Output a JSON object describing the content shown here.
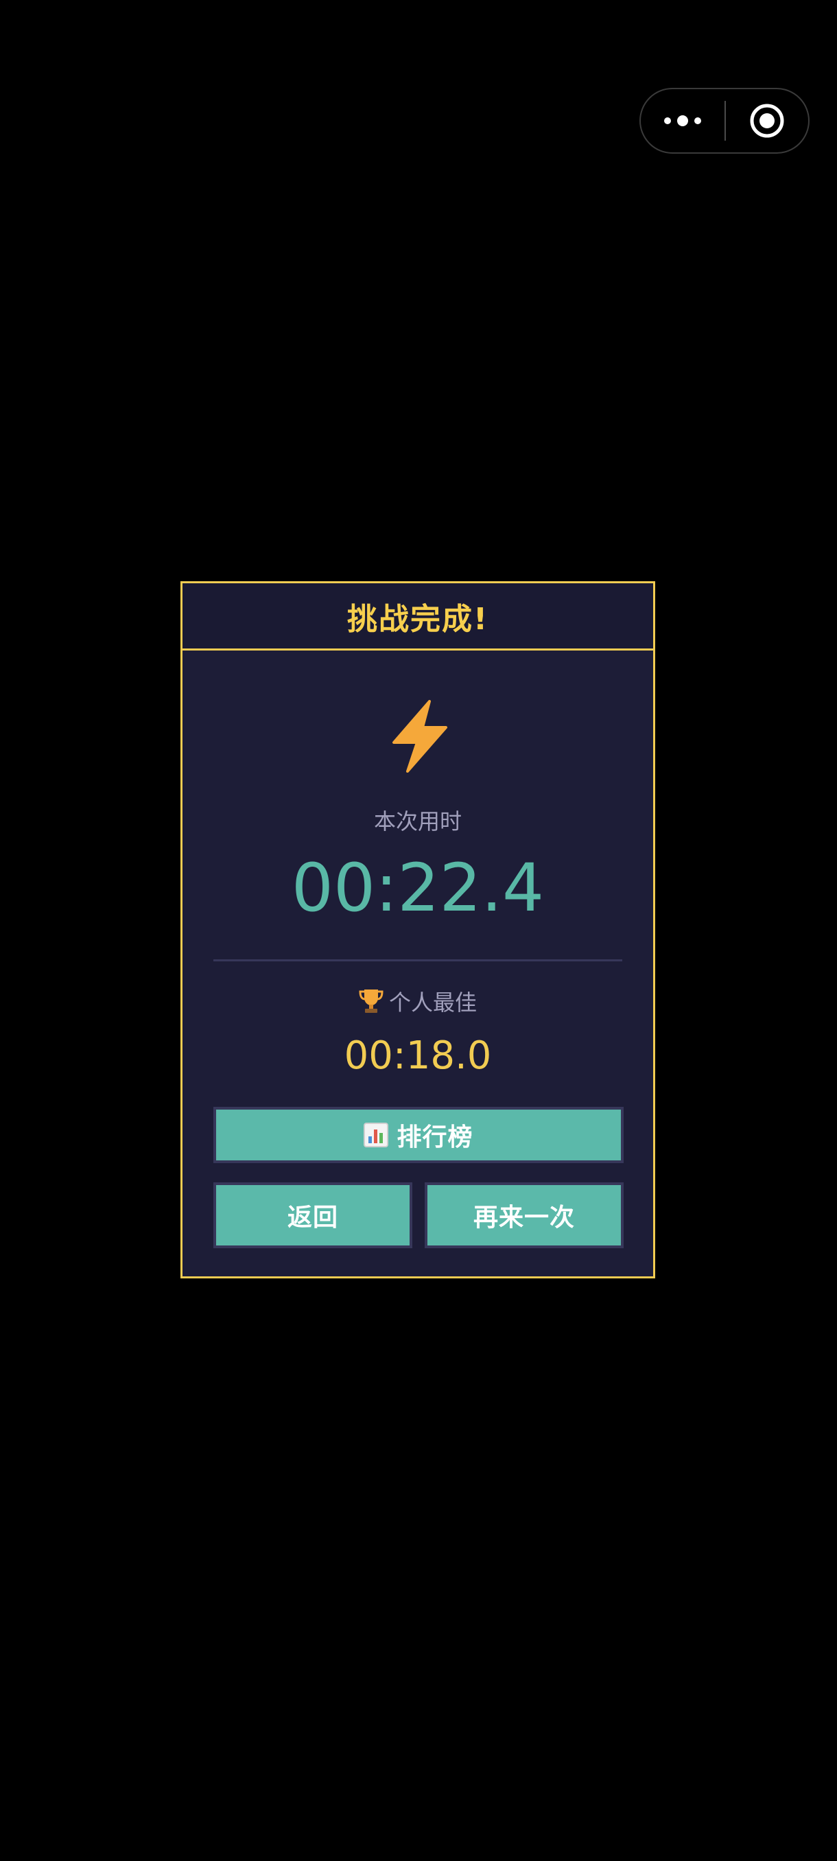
{
  "capsule": {
    "more_icon": "more-dots-icon",
    "close_icon": "target-circle-icon"
  },
  "modal": {
    "title": "挑战完成!",
    "icon": "lightning-bolt-icon",
    "current": {
      "label": "本次用时",
      "value": "00:22.4"
    },
    "best": {
      "icon": "trophy-icon",
      "label": "个人最佳",
      "value": "00:18.0"
    },
    "buttons": {
      "leaderboard_icon": "bar-chart-icon",
      "leaderboard": "排行榜",
      "back": "返回",
      "retry": "再来一次"
    }
  },
  "colors": {
    "accent_yellow": "#f2cc52",
    "teal": "#5bb9aa",
    "panel_bg": "#1d1d37",
    "muted_text": "#a1a0bc"
  }
}
